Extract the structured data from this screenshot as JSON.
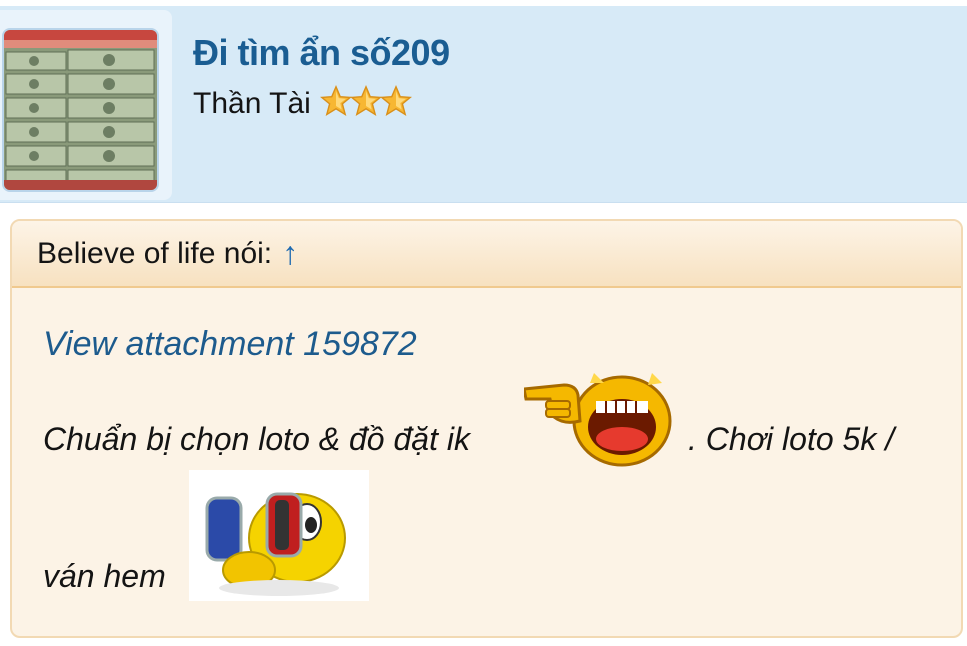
{
  "profile": {
    "username": "Đi tìm ẩn số209",
    "title": "Thần Tài",
    "star_count": 3,
    "avatar": "banknote-stack-avatar"
  },
  "quote": {
    "author_label": "Believe of life nói:",
    "jump_arrow": "↑",
    "attachment_link": "View attachment 159872",
    "line1_before_emoji": "Chuẩn bị chọn loto & đồ đặt ik",
    "line1_after_emoji": ". Chơi loto 5k /",
    "line2": "ván hem"
  },
  "icons": {
    "laugh_emoji": "laughing-pointing-emoji",
    "hide_emoji": "hiding-face-emoji",
    "star": "star-icon"
  },
  "colors": {
    "username": "#1a5d92",
    "header_bg": "#d7eaf7",
    "quote_bg": "#fcf3e6",
    "quote_border": "#f0c98e",
    "link": "#1d5b8d"
  }
}
